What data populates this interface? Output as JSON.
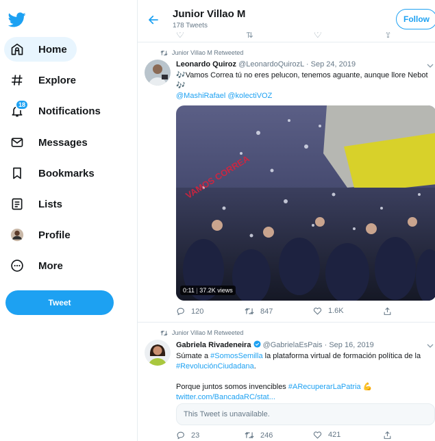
{
  "sidebar": {
    "items": [
      {
        "label": "Home",
        "icon": "home-icon"
      },
      {
        "label": "Explore",
        "icon": "hashtag-icon"
      },
      {
        "label": "Notifications",
        "icon": "bell-icon",
        "badge": "18"
      },
      {
        "label": "Messages",
        "icon": "envelope-icon"
      },
      {
        "label": "Bookmarks",
        "icon": "bookmark-icon"
      },
      {
        "label": "Lists",
        "icon": "list-icon"
      },
      {
        "label": "Profile",
        "icon": "avatar"
      },
      {
        "label": "More",
        "icon": "more-icon"
      }
    ],
    "tweet_button": "Tweet"
  },
  "header": {
    "title": "Junior Villao M",
    "subtitle": "178 Tweets",
    "follow_label": "Follow"
  },
  "tweets": [
    {
      "retweet_note": "Junior Villao M Retweeted",
      "name": "Leonardo Quiroz",
      "handle": "@LeonardoQuirozL",
      "date": "· Sep 24, 2019",
      "text_line1": "🎶Vamos Correa tú no eres pelucon, tenemos aguante, aunque llore Nebot",
      "text_line2": "🎶",
      "mentions": "@MashiRafael @kolectiVOZ",
      "media": {
        "duration": "0:11",
        "views": "37.2K views",
        "overlay_text": "VAMOS CORREA"
      },
      "replies": "120",
      "retweets": "847",
      "likes": "1.6K"
    },
    {
      "retweet_note": "Junior Villao M Retweeted",
      "name": "Gabriela Rivadeneira",
      "handle": "@GabrielaEsPais",
      "date": "· Sep 16, 2019",
      "text_pre": "Súmate a ",
      "hashtag1": "#SomosSemilla",
      "text_mid": " la plataforma virtual de formación política de la",
      "hashtag2": "#RevoluciónCiudadana",
      "text_end": ".",
      "text2_pre": "Porque juntos somos invencibles ",
      "hashtag3": "#ARecuperarLaPatria",
      "text2_emoji": "💪",
      "link": "twitter.com/BancadaRC/stat...",
      "unavailable": "This Tweet is unavailable.",
      "replies": "23",
      "retweets": "246",
      "likes": "421"
    }
  ],
  "colors": {
    "accent": "#1da1f2",
    "text": "#14171a",
    "muted": "#657786"
  }
}
